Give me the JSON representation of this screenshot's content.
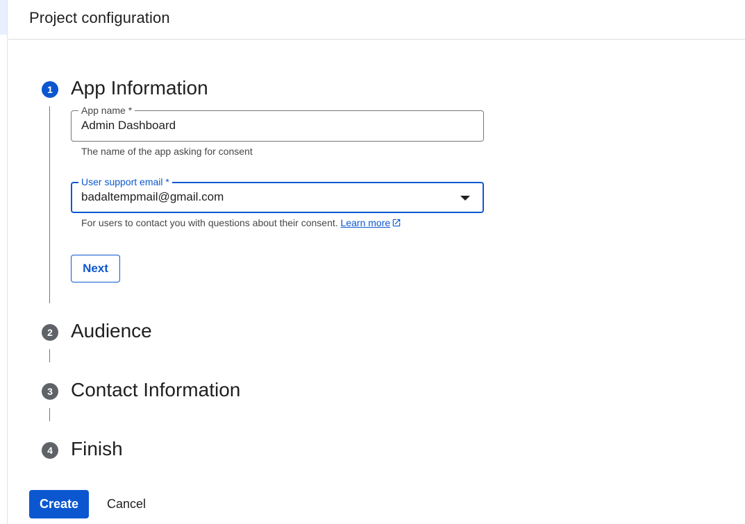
{
  "header": {
    "title": "Project configuration"
  },
  "steps": [
    {
      "number": "1",
      "title": "App Information",
      "state": "active"
    },
    {
      "number": "2",
      "title": "Audience",
      "state": "inactive"
    },
    {
      "number": "3",
      "title": "Contact Information",
      "state": "inactive"
    },
    {
      "number": "4",
      "title": "Finish",
      "state": "inactive"
    }
  ],
  "app_info": {
    "app_name": {
      "label": "App name *",
      "value": "Admin Dashboard",
      "hint": "The name of the app asking for consent"
    },
    "support_email": {
      "label": "User support email *",
      "value": "badaltempmail@gmail.com",
      "hint": "For users to contact you with questions about their consent.",
      "link": "Learn more"
    },
    "next_label": "Next"
  },
  "footer": {
    "create_label": "Create",
    "cancel_label": "Cancel"
  },
  "colors": {
    "accent": "#0b57d0",
    "inactive_step": "#5f6368"
  },
  "icons": {
    "external_link": "open-in-new-icon",
    "dropdown": "arrow-drop-down-icon"
  }
}
